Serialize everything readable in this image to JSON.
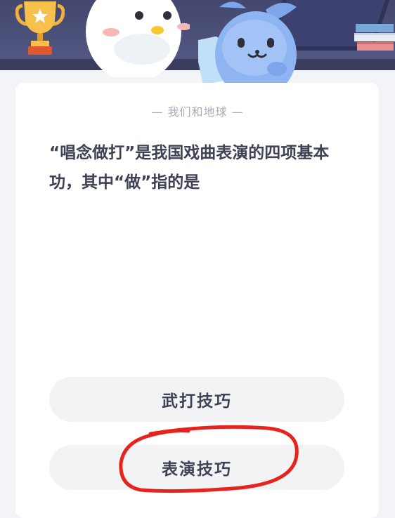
{
  "quiz": {
    "category": "— 我们和地球 —",
    "question": "“唱念做打”是我国戏曲表演的四项基本功，其中“做”指的是",
    "options": [
      {
        "label": "武打技巧"
      },
      {
        "label": "表演技巧"
      }
    ]
  },
  "colors": {
    "header_bg": "#4a4f78",
    "card_bg": "#ffffff",
    "option_bg": "#f1f3f5",
    "text_main": "#3e4254",
    "text_muted": "#a7abb8",
    "annotation_red": "#e8231d"
  },
  "icons": [
    "trophy-icon",
    "books-icon",
    "white-mascot-illustration",
    "blue-mascot-illustration"
  ]
}
